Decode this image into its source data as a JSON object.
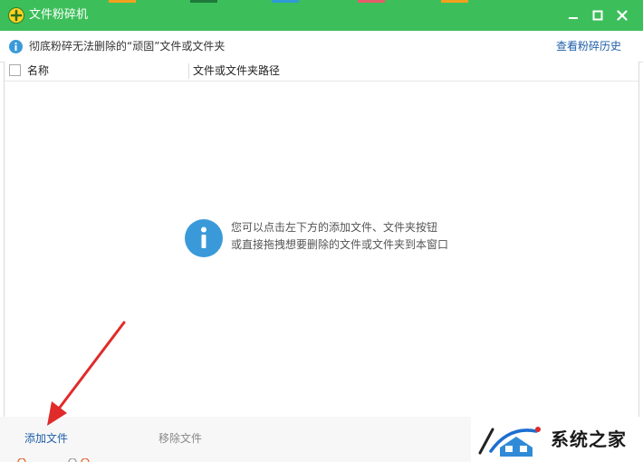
{
  "window": {
    "title": "文件粉碎机",
    "minimize_icon": "minimize-icon",
    "maximize_icon": "maximize-icon",
    "close_icon": "close-icon",
    "title_bar_color": "#3cbf5a"
  },
  "infobar": {
    "text": "彻底粉碎无法删除的“顽固”文件或文件夹",
    "history_link": "查看粉碎历史",
    "icon": "info-icon"
  },
  "table": {
    "columns": [
      "名称",
      "文件或文件夹路径"
    ],
    "rows": []
  },
  "empty_hint": {
    "icon": "info-icon",
    "line1": "您可以点击左下方的添加文件、文件夹按钮",
    "line2": "或直接拖拽想要删除的文件或文件夹到本窗口"
  },
  "bottombar": {
    "add_file": "添加文件",
    "remove_file": "移除文件"
  },
  "watermark": {
    "text": "系统之家"
  },
  "colors": {
    "accent_green": "#3cbf5a",
    "link_blue": "#1f5fa8",
    "info_blue": "#3a9ad9",
    "arrow_red": "#e02b2b"
  }
}
